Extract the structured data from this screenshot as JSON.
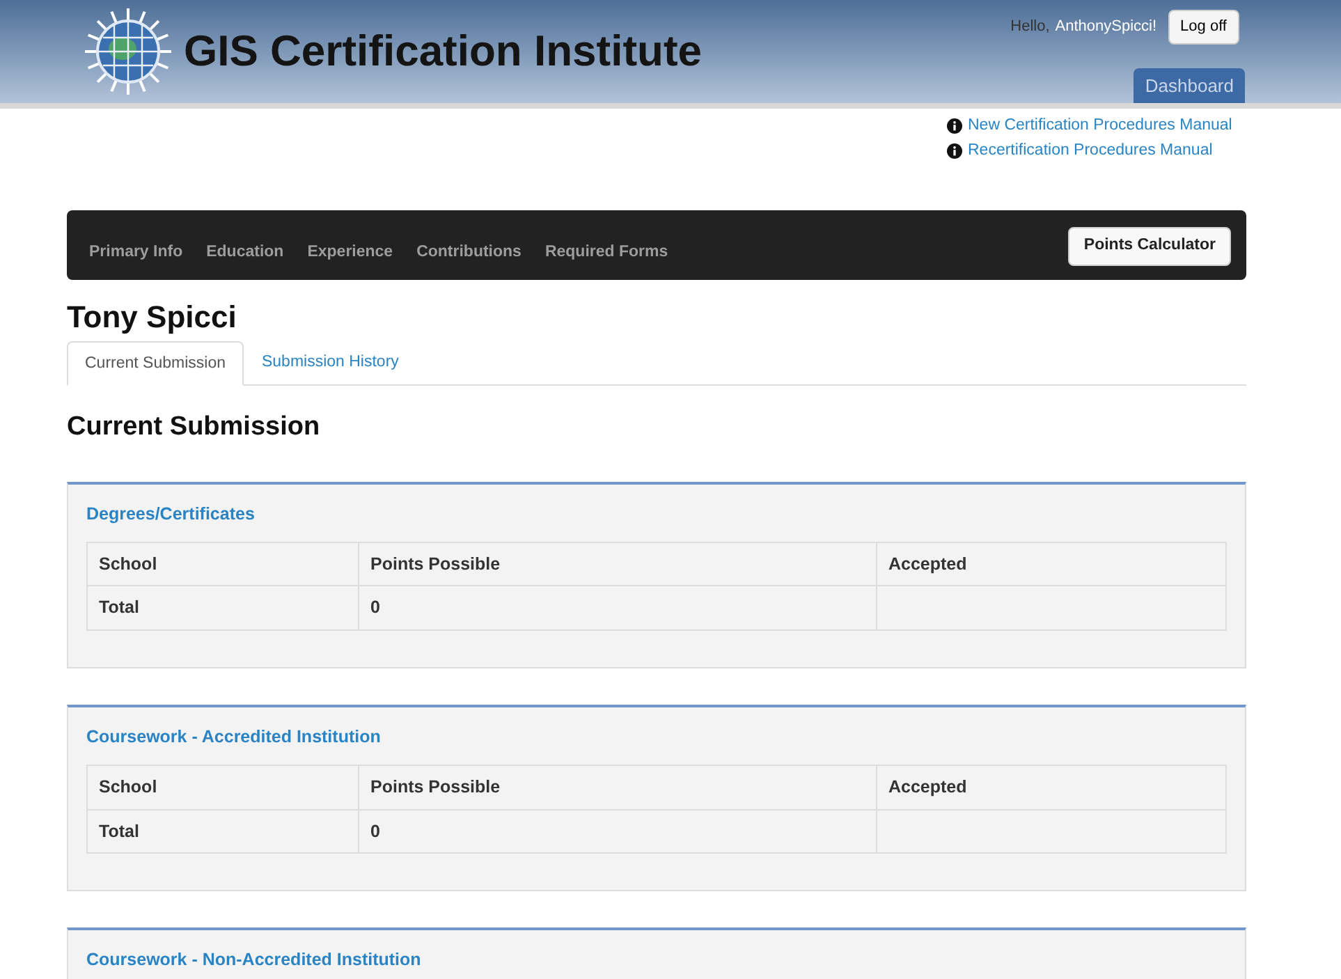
{
  "header": {
    "title": "GIS Certification Institute",
    "greeting": "Hello,",
    "username": "AnthonySpicci!",
    "logoff": "Log off",
    "tabs": [
      {
        "label": "Dashboard",
        "selected": true
      }
    ]
  },
  "manual_links": [
    "New Certification Procedures Manual",
    "Recertification Procedures Manual"
  ],
  "navbar": {
    "items": [
      "Primary Info",
      "Education",
      "Experience",
      "Contributions",
      "Required Forms"
    ],
    "button": "Points Calculator"
  },
  "person_name": "Tony Spicci",
  "tabs": [
    {
      "label": "Current Submission",
      "selected": true
    },
    {
      "label": "Submission History",
      "selected": false
    }
  ],
  "heading": "Current Submission",
  "sections": [
    {
      "title": "Degrees/Certificates",
      "table": {
        "columns": [
          "School",
          "Points Possible",
          "Accepted"
        ],
        "rows": [
          [
            "Total",
            "0",
            null
          ]
        ]
      }
    },
    {
      "title": "Coursework - Accredited Institution",
      "table": {
        "columns": [
          "School",
          "Points Possible",
          "Accepted"
        ],
        "rows": [
          [
            "Total",
            "0",
            null
          ]
        ]
      }
    },
    {
      "title": "Coursework - Non-Accredited Institution"
    }
  ]
}
